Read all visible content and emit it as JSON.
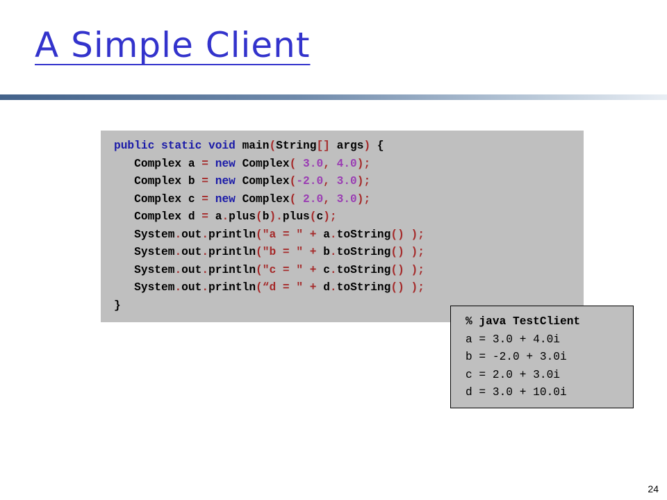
{
  "slide": {
    "title": "A Simple Client",
    "page_number": "24"
  },
  "code": {
    "lines": [
      [
        {
          "t": "kw",
          "v": "public static void "
        },
        {
          "t": "plain",
          "v": "main"
        },
        {
          "t": "op",
          "v": "("
        },
        {
          "t": "plain",
          "v": "String"
        },
        {
          "t": "op",
          "v": "[] "
        },
        {
          "t": "plain",
          "v": "args"
        },
        {
          "t": "op",
          "v": ")"
        },
        {
          "t": "plain",
          "v": " {"
        }
      ],
      [
        {
          "t": "plain",
          "v": "   Complex a "
        },
        {
          "t": "op",
          "v": "= "
        },
        {
          "t": "kw",
          "v": "new "
        },
        {
          "t": "plain",
          "v": "Complex"
        },
        {
          "t": "op",
          "v": "( "
        },
        {
          "t": "num",
          "v": "3.0"
        },
        {
          "t": "op",
          "v": ", "
        },
        {
          "t": "num",
          "v": "4.0"
        },
        {
          "t": "op",
          "v": ");"
        }
      ],
      [
        {
          "t": "plain",
          "v": "   Complex b "
        },
        {
          "t": "op",
          "v": "= "
        },
        {
          "t": "kw",
          "v": "new "
        },
        {
          "t": "plain",
          "v": "Complex"
        },
        {
          "t": "op",
          "v": "("
        },
        {
          "t": "num",
          "v": "-2.0"
        },
        {
          "t": "op",
          "v": ", "
        },
        {
          "t": "num",
          "v": "3.0"
        },
        {
          "t": "op",
          "v": ");"
        }
      ],
      [
        {
          "t": "plain",
          "v": "   Complex c "
        },
        {
          "t": "op",
          "v": "= "
        },
        {
          "t": "kw",
          "v": "new "
        },
        {
          "t": "plain",
          "v": "Complex"
        },
        {
          "t": "op",
          "v": "( "
        },
        {
          "t": "num",
          "v": "2.0"
        },
        {
          "t": "op",
          "v": ", "
        },
        {
          "t": "num",
          "v": "3.0"
        },
        {
          "t": "op",
          "v": ");"
        }
      ],
      [
        {
          "t": "plain",
          "v": "   Complex d "
        },
        {
          "t": "op",
          "v": "= "
        },
        {
          "t": "plain",
          "v": "a"
        },
        {
          "t": "op",
          "v": "."
        },
        {
          "t": "plain",
          "v": "plus"
        },
        {
          "t": "op",
          "v": "("
        },
        {
          "t": "plain",
          "v": "b"
        },
        {
          "t": "op",
          "v": ")."
        },
        {
          "t": "plain",
          "v": "plus"
        },
        {
          "t": "op",
          "v": "("
        },
        {
          "t": "plain",
          "v": "c"
        },
        {
          "t": "op",
          "v": ");"
        }
      ],
      [
        {
          "t": "plain",
          "v": "   System"
        },
        {
          "t": "op",
          "v": "."
        },
        {
          "t": "plain",
          "v": "out"
        },
        {
          "t": "op",
          "v": "."
        },
        {
          "t": "plain",
          "v": "println"
        },
        {
          "t": "op",
          "v": "("
        },
        {
          "t": "str",
          "v": "\"a = \""
        },
        {
          "t": "op",
          "v": " + "
        },
        {
          "t": "plain",
          "v": "a"
        },
        {
          "t": "op",
          "v": "."
        },
        {
          "t": "plain",
          "v": "toString"
        },
        {
          "t": "op",
          "v": "() );"
        }
      ],
      [
        {
          "t": "plain",
          "v": "   System"
        },
        {
          "t": "op",
          "v": "."
        },
        {
          "t": "plain",
          "v": "out"
        },
        {
          "t": "op",
          "v": "."
        },
        {
          "t": "plain",
          "v": "println"
        },
        {
          "t": "op",
          "v": "("
        },
        {
          "t": "str",
          "v": "\"b = \""
        },
        {
          "t": "op",
          "v": " + "
        },
        {
          "t": "plain",
          "v": "b"
        },
        {
          "t": "op",
          "v": "."
        },
        {
          "t": "plain",
          "v": "toString"
        },
        {
          "t": "op",
          "v": "() );"
        }
      ],
      [
        {
          "t": "plain",
          "v": "   System"
        },
        {
          "t": "op",
          "v": "."
        },
        {
          "t": "plain",
          "v": "out"
        },
        {
          "t": "op",
          "v": "."
        },
        {
          "t": "plain",
          "v": "println"
        },
        {
          "t": "op",
          "v": "("
        },
        {
          "t": "str",
          "v": "\"c = \""
        },
        {
          "t": "op",
          "v": " + "
        },
        {
          "t": "plain",
          "v": "c"
        },
        {
          "t": "op",
          "v": "."
        },
        {
          "t": "plain",
          "v": "toString"
        },
        {
          "t": "op",
          "v": "() );"
        }
      ],
      [
        {
          "t": "plain",
          "v": "   System"
        },
        {
          "t": "op",
          "v": "."
        },
        {
          "t": "plain",
          "v": "out"
        },
        {
          "t": "op",
          "v": "."
        },
        {
          "t": "plain",
          "v": "println"
        },
        {
          "t": "op",
          "v": "("
        },
        {
          "t": "str",
          "v": "“d = \""
        },
        {
          "t": "op",
          "v": " + "
        },
        {
          "t": "plain",
          "v": "d"
        },
        {
          "t": "op",
          "v": "."
        },
        {
          "t": "plain",
          "v": "toString"
        },
        {
          "t": "op",
          "v": "() );"
        }
      ],
      [
        {
          "t": "plain",
          "v": "}"
        }
      ]
    ]
  },
  "output": {
    "command": "% java TestClient",
    "lines": [
      "a = 3.0 + 4.0i",
      "b = -2.0 + 3.0i",
      "c = 2.0 + 3.0i",
      "d = 3.0 + 10.0i"
    ]
  },
  "colors": {
    "title": "#3333cc",
    "keyword": "#1a1aa8",
    "operator": "#a52a2a",
    "number": "#9a3db3",
    "code_background": "#bfbfbf"
  }
}
